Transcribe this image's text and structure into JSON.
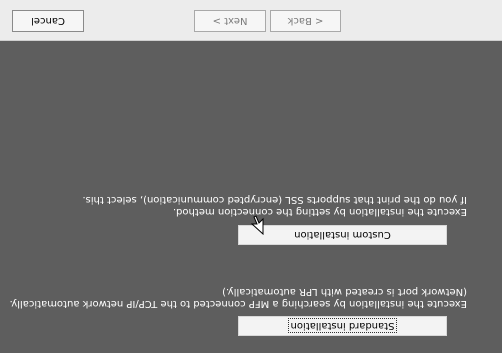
{
  "options": {
    "standard": {
      "label": "Standard installation",
      "desc1": "Execute the installation by searching a MFP connected to the TCP/IP network automatically.",
      "desc2": "(Network port is created with LPR automatically.)"
    },
    "custom": {
      "label": "Custom installation",
      "desc1": "Execute the installation by setting the connection method.",
      "desc2": "If you do the print that supports SSL (encrypted communication), select this."
    }
  },
  "buttons": {
    "back": "< Back",
    "next": "Next >",
    "cancel": "Cancel"
  },
  "colors": {
    "panel_bg": "#5e5e5e",
    "bar_bg": "#ececec"
  },
  "icons": {
    "cursor": "mouse-pointer-icon"
  }
}
